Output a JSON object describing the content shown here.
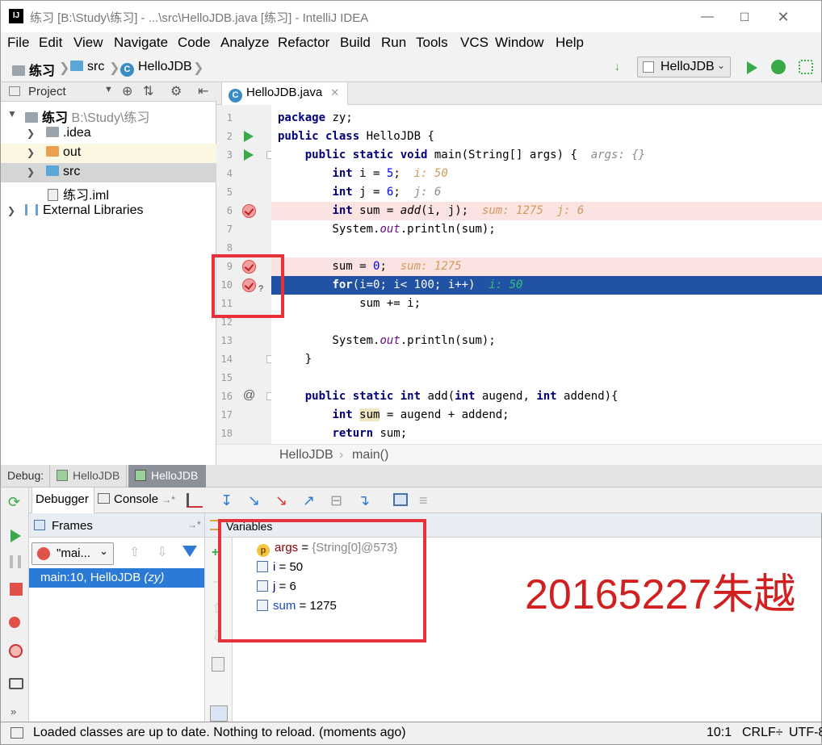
{
  "window": {
    "title": "练习 [B:\\Study\\练习] - ...\\src\\HelloJDB.java [练习] - IntelliJ IDEA",
    "app_icon": "IJ"
  },
  "menu": [
    "File",
    "Edit",
    "View",
    "Navigate",
    "Code",
    "Analyze",
    "Refactor",
    "Build",
    "Run",
    "Tools",
    "VCS",
    "Window",
    "Help"
  ],
  "breadcrumbs": [
    "练习",
    "src",
    "HelloJDB"
  ],
  "run_config": "HelloJDB",
  "project_panel": {
    "title": "Project",
    "tree": [
      {
        "label": "练习",
        "path": "B:\\Study\\练习"
      },
      {
        "label": ".idea"
      },
      {
        "label": "out"
      },
      {
        "label": "src"
      },
      {
        "label": "练习.iml"
      },
      {
        "label": "External Libraries"
      }
    ]
  },
  "editor": {
    "tab": "HelloJDB.java",
    "lines": [
      {
        "n": "1"
      },
      {
        "n": "2"
      },
      {
        "n": "3"
      },
      {
        "n": "4"
      },
      {
        "n": "5"
      },
      {
        "n": "6"
      },
      {
        "n": "7"
      },
      {
        "n": "8"
      },
      {
        "n": "9"
      },
      {
        "n": "10"
      },
      {
        "n": "11"
      },
      {
        "n": "12"
      },
      {
        "n": "13"
      },
      {
        "n": "14"
      },
      {
        "n": "15"
      },
      {
        "n": "16"
      },
      {
        "n": "17"
      },
      {
        "n": "18"
      }
    ],
    "hints": {
      "args": "args: {}",
      "i": "i: 50",
      "j": "j: 6",
      "sum": "sum: 1275",
      "j2": "j: 6",
      "sum9": "sum: 1275",
      "i10": "i: 50"
    },
    "breadcrumb": [
      "HelloJDB",
      "main()"
    ]
  },
  "debug": {
    "label": "Debug:",
    "sessions": [
      "HelloJDB",
      "HelloJDB"
    ],
    "tabs": {
      "debugger": "Debugger",
      "console": "Console"
    },
    "frames_title": "Frames",
    "thread": "\"mai...",
    "frame": "main:10, HelloJDB",
    "frame_pkg": "(zy)",
    "variables_title": "Variables",
    "variables": [
      {
        "name": "args",
        "eq": " = ",
        "value": "{String[0]@573}"
      },
      {
        "name": "i",
        "eq": " = ",
        "value": "50"
      },
      {
        "name": "j",
        "eq": " = ",
        "value": "6"
      },
      {
        "name": "sum",
        "eq": " = ",
        "value": "1275"
      }
    ],
    "annotation": "20165227朱越"
  },
  "status": {
    "message": "Loaded classes are up to date. Nothing to reload. (moments ago)",
    "position": "10:1",
    "line_sep": "CRLF÷",
    "encoding": "UTF-8"
  },
  "colors": {
    "exec_line": "#2152a3",
    "bp_line": "#fae3e0",
    "annotation": "#d0201f",
    "box": "#e8323a"
  }
}
